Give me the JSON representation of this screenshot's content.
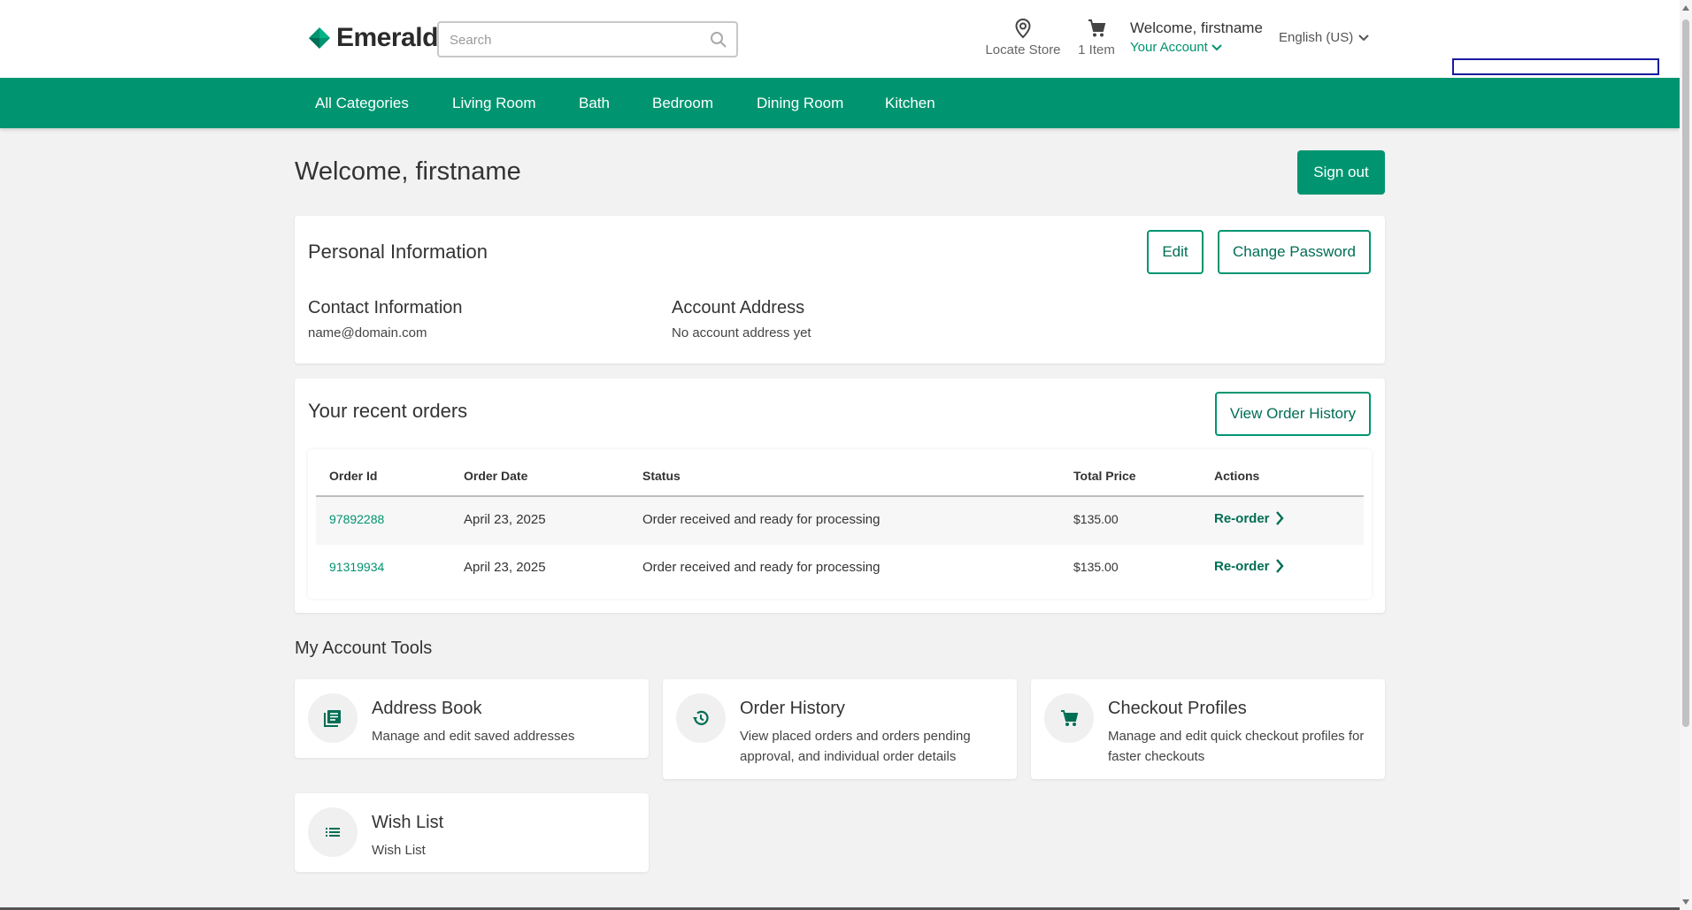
{
  "brand": {
    "name": "Emerald",
    "accent": "#009570"
  },
  "header": {
    "search_placeholder": "Search",
    "locate_label": "Locate Store",
    "cart_label": "1 Item",
    "welcome": "Welcome, firstname",
    "account_label": "Your Account",
    "language": "English (US)"
  },
  "nav": {
    "items": [
      "All Categories",
      "Living Room",
      "Bath",
      "Bedroom",
      "Dining Room",
      "Kitchen"
    ]
  },
  "page": {
    "title": "Welcome, firstname",
    "sign_out": "Sign out"
  },
  "personal": {
    "title": "Personal Information",
    "edit": "Edit",
    "change_password": "Change Password",
    "contact_title": "Contact Information",
    "email": "name@domain.com",
    "address_title": "Account Address",
    "address_value": "No account address yet"
  },
  "orders": {
    "title": "Your recent orders",
    "view_history": "View Order History",
    "columns": [
      "Order Id",
      "Order Date",
      "Status",
      "Total Price",
      "Actions"
    ],
    "rows": [
      {
        "id": "97892288",
        "date": "April 23, 2025",
        "status": "Order received and ready for processing",
        "total": "$135.00",
        "action": "Re-order"
      },
      {
        "id": "91319934",
        "date": "April 23, 2025",
        "status": "Order received and ready for processing",
        "total": "$135.00",
        "action": "Re-order"
      }
    ]
  },
  "tools": {
    "title": "My Account Tools",
    "items": [
      {
        "title": "Address Book",
        "desc": "Manage and edit saved addresses",
        "icon": "address-book-icon"
      },
      {
        "title": "Order History",
        "desc": "View placed orders and orders pending approval, and individual order details",
        "icon": "history-icon"
      },
      {
        "title": "Checkout Profiles",
        "desc": "Manage and edit quick checkout profiles for faster checkouts",
        "icon": "cart-icon"
      },
      {
        "title": "Wish List",
        "desc": "Wish List",
        "icon": "list-icon"
      }
    ]
  }
}
